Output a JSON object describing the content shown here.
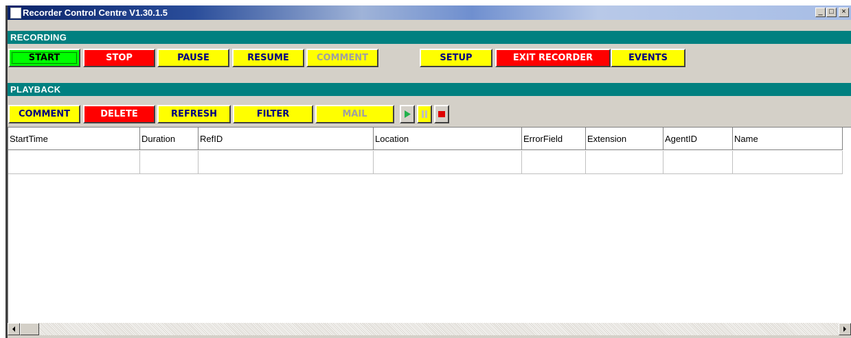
{
  "window": {
    "title": "Recorder Control Centre V1.30.1.5",
    "caption_buttons": {
      "minimize": "_",
      "maximize": "□",
      "close": "×"
    }
  },
  "recording": {
    "header": "RECORDING",
    "buttons": {
      "start": "START",
      "stop": "STOP",
      "pause": "PAUSE",
      "resume": "RESUME",
      "comment": "COMMENT",
      "setup": "SETUP",
      "exit": "EXIT RECORDER",
      "events": "EVENTS"
    }
  },
  "playback": {
    "header": "PLAYBACK",
    "buttons": {
      "comment": "COMMENT",
      "delete": "DELETE",
      "refresh": "REFRESH",
      "filter": "FILTER",
      "mail": "MAIL"
    },
    "media_controls": [
      "play-icon",
      "pause-icon",
      "stop-icon"
    ]
  },
  "grid": {
    "columns": [
      "StartTime",
      "Duration",
      "RefID",
      "Location",
      "ErrorField",
      "Extension",
      "AgentID",
      "Name"
    ],
    "rows": [
      [
        "",
        "",
        "",
        "",
        "",
        "",
        "",
        ""
      ]
    ]
  },
  "colors": {
    "teal_header": "#008080",
    "button_yellow": "#ffff00",
    "button_red": "#ff0000",
    "button_green": "#00ff00",
    "button_text_navy": "#000080"
  }
}
